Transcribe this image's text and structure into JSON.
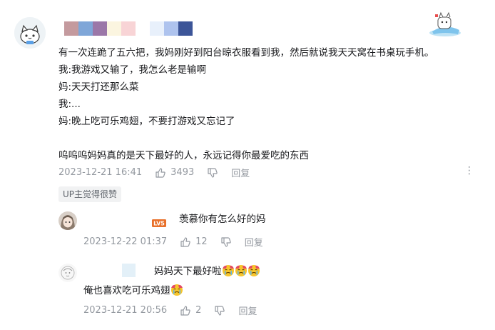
{
  "main_comment": {
    "lines": [
      "有一次连跪了五六把，我妈刚好到阳台晾衣服看到我，然后就说我天天窝在书桌玩手机。",
      "我:我游戏又输了，我怎么老是输啊",
      "妈:天天打还那么菜",
      "我:...",
      "妈:晚上吃可乐鸡翅，不要打游戏又忘记了",
      "",
      "呜呜呜妈妈真的是天下最好的人，永远记得你最爱吃的东西"
    ],
    "time": "2023-12-21 16:41",
    "likes": "3493",
    "reply_label": "回复",
    "more_glyph": "⋮",
    "up_tag": "UP主觉得很赞",
    "username_mosaic_colors": [
      "#c49a9e",
      "#7fa6d8",
      "#9b77a8",
      "#fbf5e0",
      "#f8d4d6",
      "#ffffff",
      "#e8f0fb",
      "#aec3ee",
      "#3c5598"
    ]
  },
  "replies": [
    {
      "level_badge": "LV5",
      "text": "羡慕你有怎么好的妈",
      "time": "2023-12-22 01:37",
      "likes": "12",
      "reply_label": "回复"
    },
    {
      "text_line1": "妈妈天下最好啦",
      "text_line2": "俺也喜欢吃可乐鸡翅",
      "time": "2023-12-21 20:56",
      "likes": "2",
      "reply_label": "回复"
    }
  ],
  "icons": {
    "like": "thumbs-up-icon",
    "dislike": "thumbs-down-icon",
    "more": "more-vertical-icon",
    "emoji": "crying-face-emoji"
  },
  "colors": {
    "text": "#18191c",
    "meta": "#9499a0",
    "tag_bg": "#f1f2f3",
    "level_badge": "#e8702a"
  }
}
